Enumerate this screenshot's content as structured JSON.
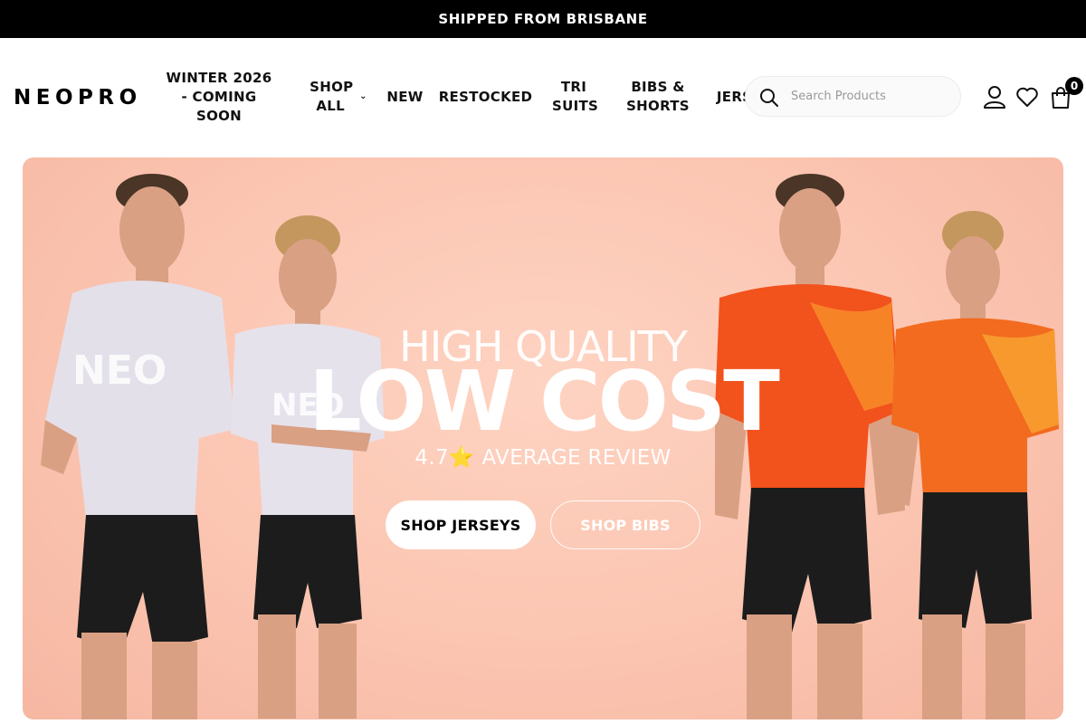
{
  "announcement": {
    "text": "SHIPPED FROM BRISBANE"
  },
  "header": {
    "logo": "NEOPRO",
    "nav": [
      {
        "label": "WINTER 2026 - COMING SOON"
      },
      {
        "label": "SHOP ALL",
        "has_dropdown": true
      },
      {
        "label": "NEW"
      },
      {
        "label": "RESTOCKED"
      },
      {
        "label": "TRI SUITS"
      },
      {
        "label": "BIBS & SHORTS"
      },
      {
        "label": "JERSEYS"
      }
    ],
    "search": {
      "placeholder": "Search Products",
      "icon": "search-icon"
    },
    "icons": [
      "account-icon",
      "wishlist-heart-icon",
      "cart-icon"
    ],
    "cart_count": "0"
  },
  "hero": {
    "subtitle": "HIGH QUALITY",
    "title": "LOW COST",
    "rating": "4.7",
    "rating_icon": "⭐",
    "review_text": "AVERAGE REVIEW",
    "buttons": {
      "primary": "SHOP JERSEYS",
      "secondary": "SHOP BIBS"
    },
    "colors": {
      "background": "#fbc5b1",
      "jersey_left": "#e4e0ea",
      "jersey_right": "#f2521c"
    }
  }
}
